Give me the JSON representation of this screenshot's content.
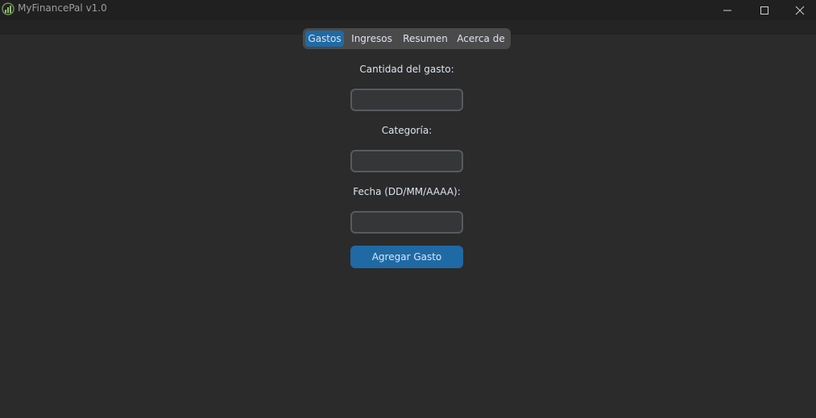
{
  "window": {
    "title": "MyFinancePal v1.0",
    "icon": "finance-chart-icon"
  },
  "controls": {
    "minimize_icon": "minimize-icon",
    "maximize_icon": "maximize-icon",
    "close_icon": "close-icon"
  },
  "tabs": [
    {
      "label": "Gastos",
      "active": true
    },
    {
      "label": "Ingresos",
      "active": false
    },
    {
      "label": "Resumen",
      "active": false
    },
    {
      "label": "Acerca de",
      "active": false
    }
  ],
  "form": {
    "amount_label": "Cantidad del gasto:",
    "amount_value": "",
    "category_label": "Categoría:",
    "category_value": "",
    "date_label": "Fecha (DD/MM/AAAA):",
    "date_value": "",
    "submit_label": "Agregar Gasto"
  },
  "colors": {
    "accent": "#1f6aa5",
    "background": "#2b2b2b",
    "titlebar": "#202020",
    "text": "#dce4ee"
  }
}
